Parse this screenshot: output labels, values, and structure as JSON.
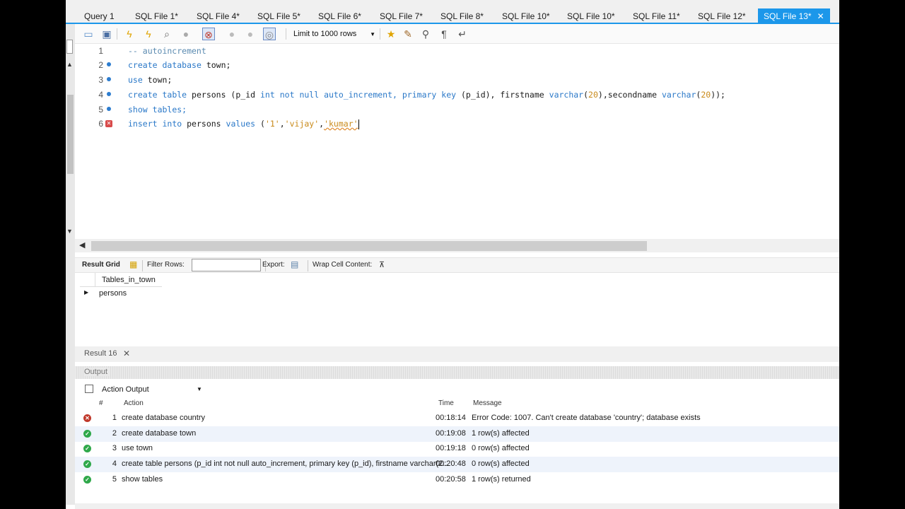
{
  "tabs": [
    {
      "label": "Query 1"
    },
    {
      "label": "SQL File 1*"
    },
    {
      "label": "SQL File 4*"
    },
    {
      "label": "SQL File 5*"
    },
    {
      "label": "SQL File 6*"
    },
    {
      "label": "SQL File 7*"
    },
    {
      "label": "SQL File 8*"
    },
    {
      "label": "SQL File 10*"
    },
    {
      "label": "SQL File 10*"
    },
    {
      "label": "SQL File 11*"
    },
    {
      "label": "SQL File 12*"
    },
    {
      "label": "SQL File 13*",
      "active": true,
      "close": "✕"
    }
  ],
  "toolbar": {
    "icons": [
      "open-file-icon",
      "save-icon",
      "execute-icon",
      "execute-current-icon",
      "explain-icon",
      "stop-icon",
      "toggle-continue-icon",
      "commit-icon",
      "rollback-icon",
      "autocommit-icon",
      "favorite-icon",
      "beautify-icon",
      "find-icon",
      "invisible-chars-icon",
      "wrap-icon"
    ],
    "limit": "Limit to 1000 rows"
  },
  "editor": {
    "lines": [
      {
        "no": "1",
        "marker": "none"
      },
      {
        "no": "2",
        "marker": "ok"
      },
      {
        "no": "3",
        "marker": "ok"
      },
      {
        "no": "4",
        "marker": "ok"
      },
      {
        "no": "5",
        "marker": "ok"
      },
      {
        "no": "6",
        "marker": "error"
      }
    ],
    "tokens": {
      "l1": "-- autoincrement",
      "l2": [
        "create",
        "database",
        "town;"
      ],
      "l3": [
        "use",
        "town;"
      ],
      "l4": [
        "create",
        "table",
        "persons (p_id",
        "int",
        "not",
        "null",
        "auto_increment,",
        "primary",
        "key",
        "(p_id), firstname",
        "varchar",
        "(",
        "20",
        "),secondname",
        "varchar",
        "(",
        "20",
        "));"
      ],
      "l5": [
        "show",
        "tables;"
      ],
      "l6": [
        "insert",
        "into",
        "persons",
        "values",
        "(",
        "'1'",
        ",",
        "'vijay'",
        ",",
        "'kumar'"
      ]
    }
  },
  "result_toolbar": {
    "result_grid": "Result Grid",
    "filter_rows": "Filter Rows:",
    "filter_value": "",
    "export": "Export:",
    "wrap": "Wrap Cell Content:"
  },
  "grid": {
    "column": "Tables_in_town",
    "rows": [
      "persons"
    ]
  },
  "result_tab": {
    "label": "Result 16",
    "close": "✕"
  },
  "output": {
    "title": "Output",
    "selector": "Action Output",
    "headers": {
      "num": "#",
      "action": "Action",
      "time": "Time",
      "message": "Message"
    },
    "rows": [
      {
        "status": "error",
        "num": "1",
        "action": "create database country",
        "time": "00:18:14",
        "message": "Error Code: 1007. Can't create database 'country'; database exists"
      },
      {
        "status": "ok",
        "num": "2",
        "action": "create database town",
        "time": "00:19:08",
        "message": "1 row(s) affected"
      },
      {
        "status": "ok",
        "num": "3",
        "action": "use town",
        "time": "00:19:18",
        "message": "0 row(s) affected"
      },
      {
        "status": "ok",
        "num": "4",
        "action": "create table persons (p_id int not null auto_increment, primary key (p_id), firstname varchar(2...",
        "time": "00:20:48",
        "message": "0 row(s) affected"
      },
      {
        "status": "ok",
        "num": "5",
        "action": "show tables",
        "time": "00:20:58",
        "message": "1 row(s) returned"
      }
    ]
  }
}
